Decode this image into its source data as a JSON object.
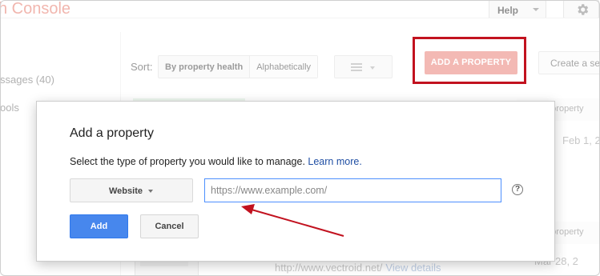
{
  "app": {
    "brand": "h Console",
    "help_label": "Help",
    "sidebar": {
      "messages": "ssages (40)",
      "tools": "ools"
    },
    "sort_label": "Sort:",
    "sort_options": [
      "By property health",
      "Alphabetically"
    ],
    "add_property_label": "ADD A PROPERTY",
    "create_set_label": "Create a set",
    "card_label_1": "e property",
    "date_1": "Feb 1, 2",
    "card_label_2": "e property",
    "date_2": "Mar 28, 2",
    "bottom_url": "http://www.vectroid.net/",
    "bottom_link": "View details"
  },
  "dialog": {
    "title": "Add a property",
    "prompt": "Select the type of property you would like to manage.",
    "learn_more": "Learn more.",
    "type_selected": "Website",
    "url_placeholder": "https://www.example.com/",
    "url_value": "",
    "help_icon_glyph": "?",
    "add_label": "Add",
    "cancel_label": "Cancel"
  },
  "colors": {
    "primary_button": "#4787ed",
    "highlight": "#c2121f",
    "add_property_button": "#f3b9b4",
    "link": "#1f4ea3"
  }
}
